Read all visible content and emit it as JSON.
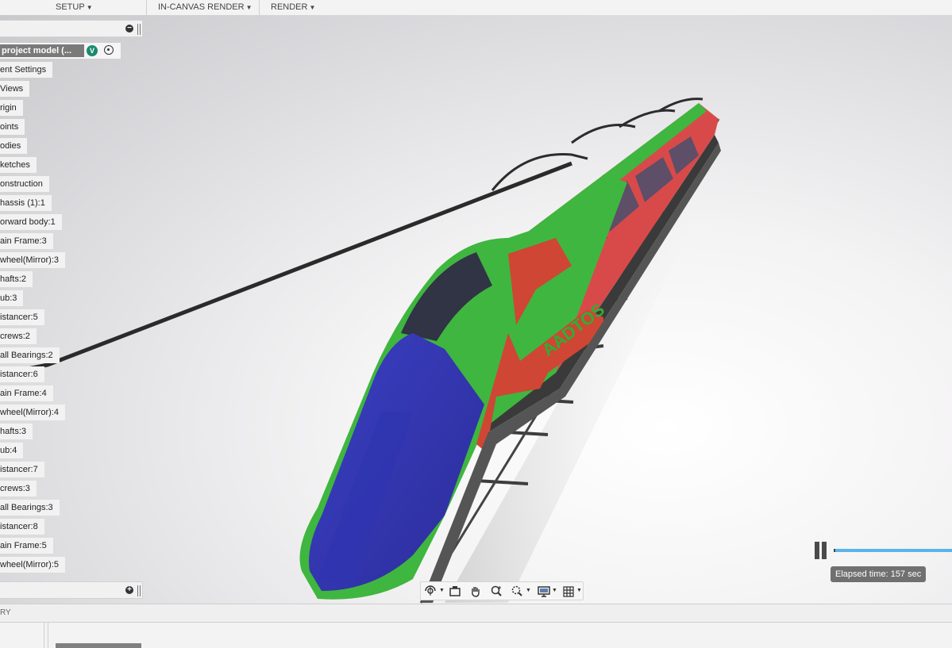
{
  "toolbar": {
    "menus": [
      {
        "label": "SETUP"
      },
      {
        "label": "IN-CANVAS RENDER"
      },
      {
        "label": "RENDER"
      }
    ]
  },
  "browser": {
    "root_label": "project model (...",
    "version_badge": "V",
    "items": [
      "ent Settings",
      " Views",
      "rigin",
      "oints",
      "odies",
      "ketches",
      "onstruction",
      "hassis (1):1",
      "orward body:1",
      "ain Frame:3",
      "wheel(Mirror):3",
      "hafts:2",
      "ub:3",
      "istancer:5",
      "crews:2",
      "all Bearings:2",
      "istancer:6",
      "ain Frame:4",
      "wheel(Mirror):4",
      "hafts:3",
      "ub:4",
      "istancer:7",
      "crews:3",
      "all Bearings:3",
      "istancer:8",
      "ain Frame:5",
      "wheel(Mirror):5"
    ]
  },
  "render": {
    "elapsed": "Elapsed time: 157 sec",
    "progress_color": "#5ab4ea"
  },
  "navbar": {
    "icons": [
      "orbit-icon",
      "look-at-icon",
      "pan-icon",
      "zoom-icon",
      "fit-icon",
      "display-settings-icon",
      "grid-settings-icon"
    ]
  },
  "status": {
    "text": "RY"
  },
  "model_text": {
    "livery": "AADTOS"
  }
}
